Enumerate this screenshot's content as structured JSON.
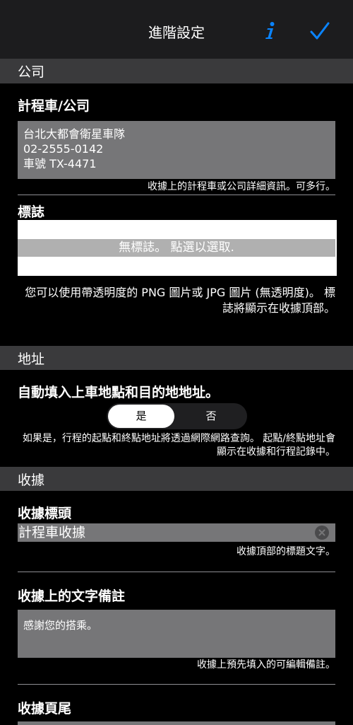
{
  "nav": {
    "title": "進階設定",
    "info_icon": "info-icon",
    "done_icon": "checkmark-icon"
  },
  "sections": {
    "company": "公司",
    "address": "地址",
    "receipt": "收據"
  },
  "taxi": {
    "heading": "計程車/公司",
    "value": "台北大都會衛星車隊\n02-2555-0142\n車號 TX-4471",
    "hint": "收據上的計程車或公司詳細資訊。可多行。"
  },
  "logo": {
    "heading": "標誌",
    "placeholder": "無標誌。 點選以選取.",
    "hint": "您可以使用帶透明度的 PNG 圖片或 JPG 圖片 (無透明度)。 標誌將顯示在收據頂部。"
  },
  "autofill": {
    "heading": "自動填入上車地點和目的地地址。",
    "options": [
      "是",
      "否"
    ],
    "selected": "是",
    "hint": "如果是，行程的起點和終點地址將透過網際網路查詢。 起點/終點地址會顯示在收據和行程記錄中。"
  },
  "receipt_header": {
    "heading": "收據標頭",
    "value": "計程車收據",
    "hint": "收據頂部的標題文字。"
  },
  "receipt_note": {
    "heading": "收據上的文字備註",
    "value": "感謝您的搭乘。",
    "hint": "收據上預先填入的可編輯備註。"
  },
  "receipt_footer": {
    "heading": "收據頁尾"
  },
  "colors": {
    "accent": "#0a84ff",
    "section_bg": "#3a3a3c",
    "field_bg": "#767678"
  }
}
